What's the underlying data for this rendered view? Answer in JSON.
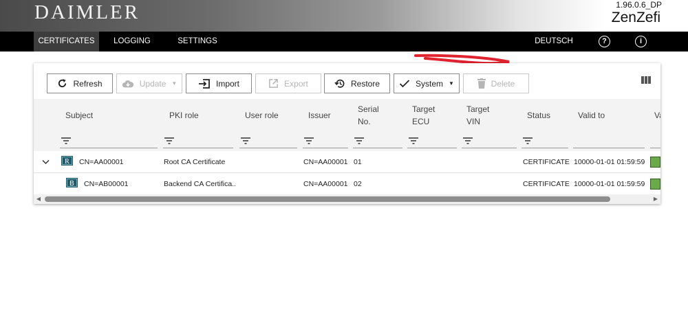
{
  "header": {
    "logo": "DAIMLER",
    "version": "1.96.0.6_DP",
    "app_name": "ZenZefi"
  },
  "nav": {
    "tabs": [
      {
        "label": "CERTIFICATES",
        "active": true
      },
      {
        "label": "LOGGING",
        "active": false
      },
      {
        "label": "SETTINGS",
        "active": false
      }
    ],
    "language": "DEUTSCH"
  },
  "toolbar": {
    "refresh": "Refresh",
    "update": "Update",
    "import": "Import",
    "export": "Export",
    "restore": "Restore",
    "system": "System",
    "delete": "Delete"
  },
  "columns": {
    "subject": "Subject",
    "pki_role": "PKI role",
    "user_role": "User role",
    "issuer": "Issuer",
    "serial_l1": "Serial",
    "serial_l2": "No.",
    "target_ecu_l1": "Target",
    "target_ecu_l2": "ECU",
    "target_vin_l1": "Target",
    "target_vin_l2": "VIN",
    "status": "Status",
    "valid_to": "Valid to",
    "valid_cut": "Va"
  },
  "rows": [
    {
      "badge": "R",
      "subject": "CN=AA00001",
      "pki_role": "Root CA Certificate",
      "issuer": "CN=AA00001",
      "serial": "01",
      "status": "CERTIFICATE",
      "valid_to": "10000-01-01 01:59:59"
    },
    {
      "badge": "B",
      "subject": "CN=AB00001",
      "pki_role": "Backend CA Certifica...",
      "issuer": "CN=AA00001",
      "serial": "02",
      "status": "CERTIFICATE",
      "valid_to": "10000-01-01 01:59:59"
    }
  ],
  "colors": {
    "nav_bg": "#000000",
    "active_tab": "#3d3d3d",
    "status_ok": "#6aaa4a",
    "badge": "#1f5a6b",
    "annotation": "#e0232f"
  },
  "icons": {
    "help": "question-circle-icon",
    "info": "info-circle-icon",
    "refresh": "refresh-icon",
    "update": "cloud-download-icon",
    "import": "import-icon",
    "export": "export-icon",
    "restore": "restore-icon",
    "system": "checkmark-icon",
    "delete": "trash-icon",
    "columns": "columns-icon",
    "filter": "filter-icon",
    "expand": "chevron-down-icon"
  }
}
